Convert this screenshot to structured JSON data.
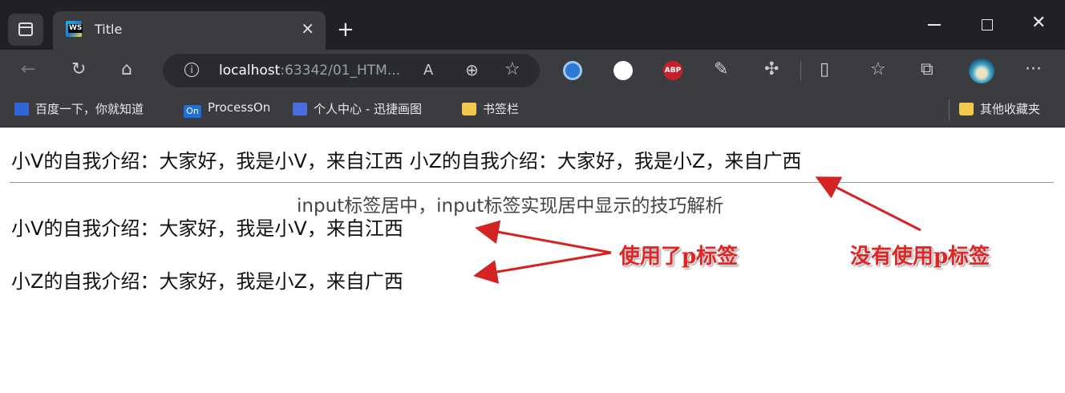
{
  "tab": {
    "title": "Title",
    "close": "×"
  },
  "toolbar": {
    "url_host": "localhost",
    "url_rest": ":63342/01_HTM..."
  },
  "bookmarks": [
    {
      "label": "百度一下，你就知道"
    },
    {
      "label": "ProcessOn",
      "icon_text": "On"
    },
    {
      "label": "个人中心 - 迅捷画图"
    },
    {
      "label": "书签栏"
    }
  ],
  "other_bookmarks": "其他收藏夹",
  "content": {
    "line1": "小V的自我介绍：大家好，我是小V，来自江西 小Z的自我介绍：大家好，我是小Z，来自广西",
    "watermark": "input标签居中，input标签实现居中显示的技巧解析",
    "line2": "小V的自我介绍：大家好，我是小V，来自江西",
    "line3": "小Z的自我介绍：大家好，我是小Z，来自广西",
    "annotation_used": "使用了p标签",
    "annotation_not_used": "没有使用p标签"
  },
  "colors": {
    "annotation": "#e02525",
    "chrome_dark": "#202124",
    "chrome": "#3b3c3f"
  }
}
